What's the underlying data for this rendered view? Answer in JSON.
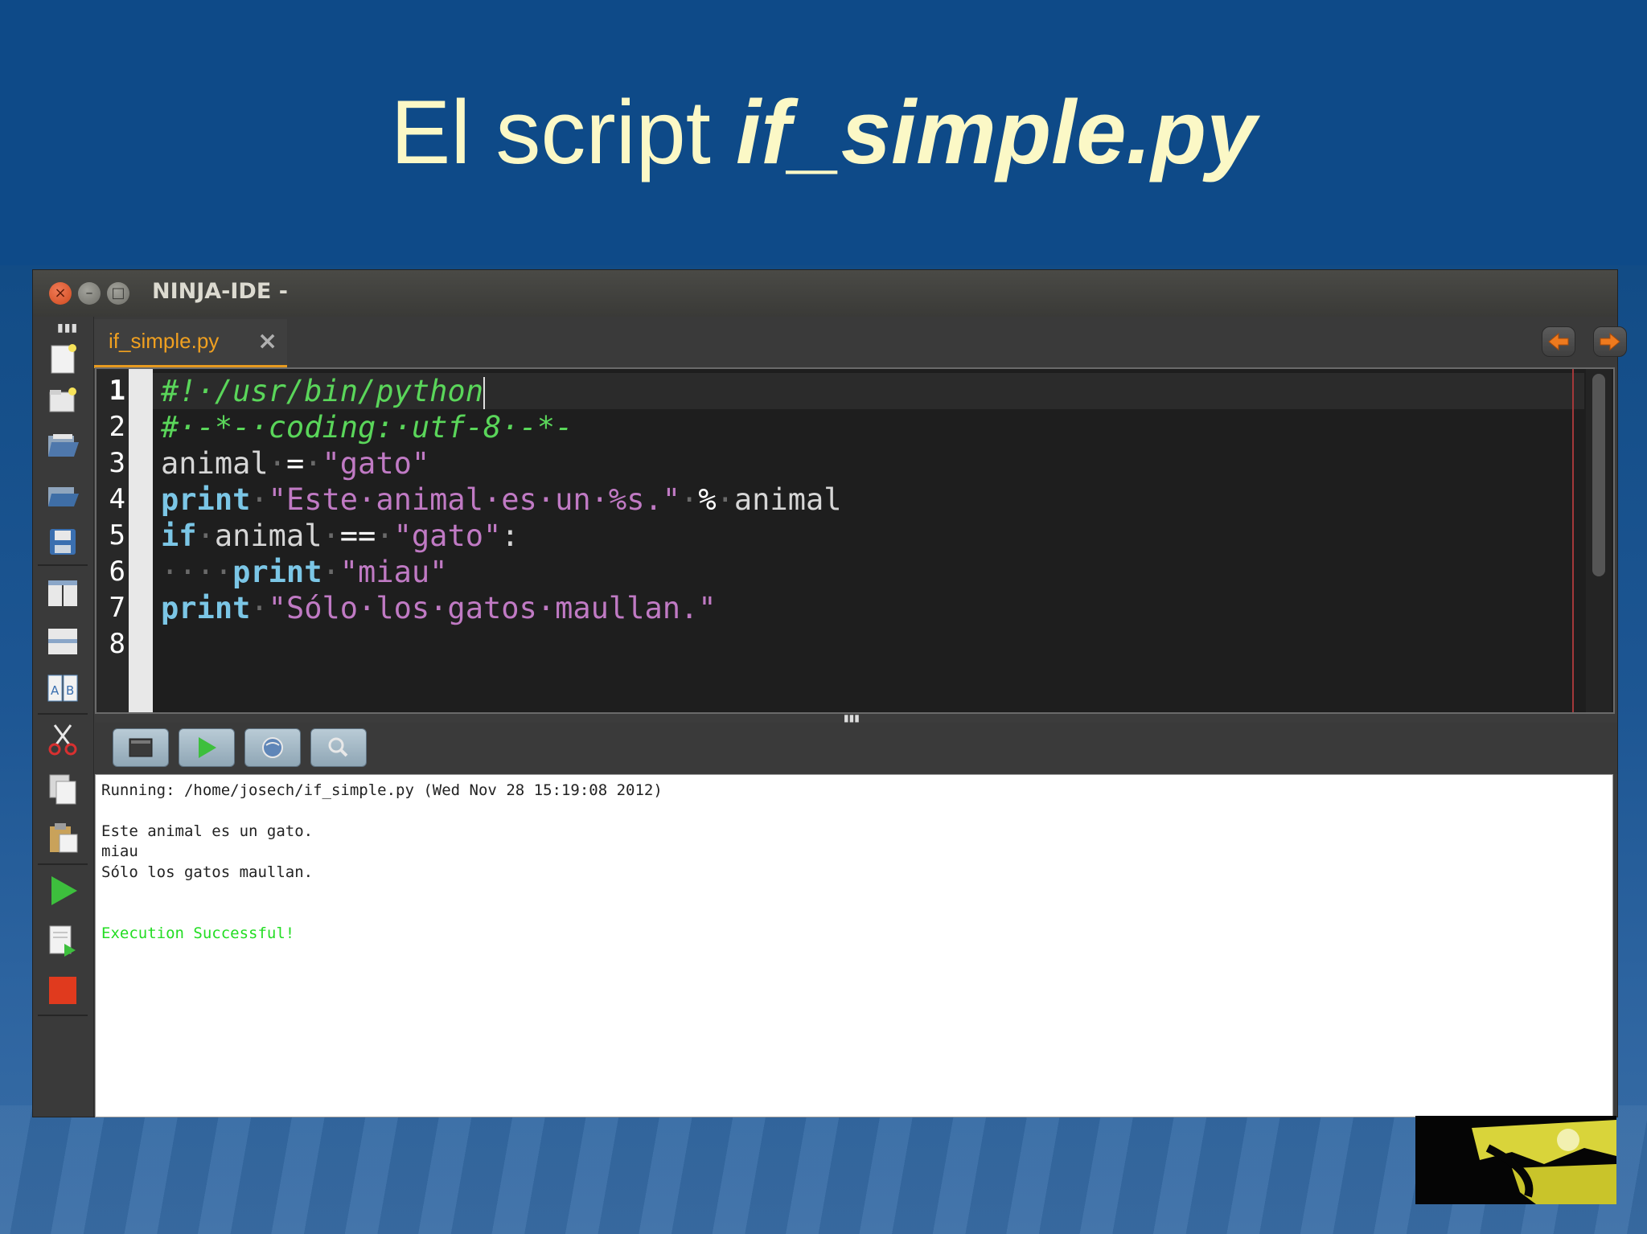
{
  "slide": {
    "title_prefix": "El script ",
    "title_emph": "if_simple.py"
  },
  "window": {
    "title": "NINJA-IDE -",
    "close_glyph": "×",
    "minimize_glyph": "–",
    "maximize_glyph": "□"
  },
  "tabs": [
    {
      "label": "if_simple.py",
      "close_glyph": "×",
      "active": true
    }
  ],
  "editor": {
    "line_numbers": [
      "1",
      "2",
      "3",
      "4",
      "5",
      "6",
      "7",
      "8"
    ],
    "lines": [
      {
        "comment": "#!·/usr/bin/python"
      },
      {
        "comment": "#·-*-·coding:·utf-8·-*-"
      },
      {
        "var": "animal",
        "dot1": "·",
        "op": "=",
        "dot2": "·",
        "str": "\"gato\""
      },
      {
        "kw": "print",
        "dot1": "·",
        "str": "\"Este·animal·es·un·%s.\"",
        "dot2": "·",
        "op": "%",
        "dot3": "·",
        "var": "animal"
      },
      {
        "kw": "if",
        "dot1": "·",
        "var": "animal",
        "dot2": "·",
        "op": "==",
        "dot3": "·",
        "str": "\"gato\"",
        "tail": ":"
      },
      {
        "indent": "····",
        "kw": "print",
        "dot1": "·",
        "str": "\"miau\""
      },
      {
        "kw": "print",
        "dot1": "·",
        "str": "\"Sólo·los·gatos·maullan.\""
      },
      {}
    ]
  },
  "run_panel": {
    "buttons": [
      "console-icon",
      "run-icon",
      "web-icon",
      "search-icon"
    ]
  },
  "console": {
    "running": "Running: /home/josech/if_simple.py (Wed Nov 28 15:19:08 2012)",
    "output": [
      "Este animal es un gato.",
      "miau",
      "Sólo los gatos maullan."
    ],
    "status": "Execution Successful!"
  },
  "toolbar_icons": [
    "new-file-icon",
    "new-project-icon",
    "open-file-icon",
    "open-project-icon",
    "save-icon",
    "split-vertical-icon",
    "split-horizontal-icon",
    "compare-icon",
    "cut-icon",
    "copy-icon",
    "paste-icon",
    "run-project-icon",
    "run-file-icon",
    "stop-icon"
  ],
  "colors": {
    "slide_bg": "#0e4a88",
    "title": "#fbf8c6",
    "tab_accent": "#e79a1f",
    "comment": "#5ad65a",
    "keyword": "#7bc6e6",
    "string": "#c07ac4",
    "success": "#22dd22"
  }
}
